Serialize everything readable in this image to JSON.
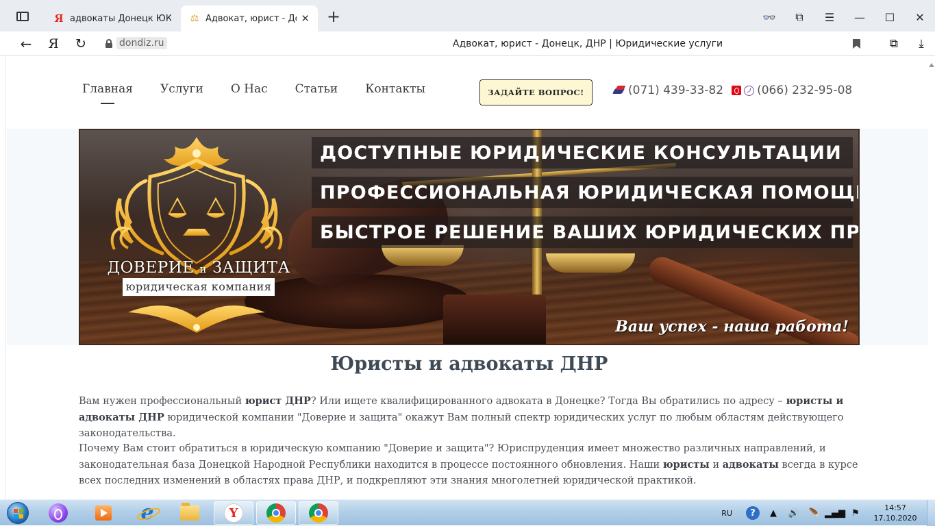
{
  "browser": {
    "tabs": [
      {
        "label": "адвокаты Донецк ЮК \"Дов",
        "favicon": "yandex-icon"
      },
      {
        "label": "Адвокат, юрист - Донец",
        "favicon": "scales-icon",
        "active": true
      }
    ],
    "address": {
      "domain": "dondiz.ru",
      "page_title": "Адвокат, юрист - Донецк, ДНР | Юридические услуги"
    }
  },
  "site": {
    "nav": [
      "Главная",
      "Услуги",
      "О Нас",
      "Статьи",
      "Контакты"
    ],
    "ask_button": "ЗАДАЙТЕ ВОПРОС!",
    "phone1": "(071) 439-33-82",
    "phone2": "(066) 232-95-08",
    "banner": {
      "slogan1": "ДОСТУПНЫЕ ЮРИДИЧЕСКИЕ КОНСУЛЬТАЦИИ",
      "slogan2": "ПРОФЕССИОНАЛЬНАЯ ЮРИДИЧЕСКАЯ ПОМОЩЬ",
      "slogan3": "БЫСТРОЕ РЕШЕНИЕ ВАШИХ ЮРИДИЧЕСКИХ ПРОБЛЕМ",
      "motto": "Ваш успех - наша работа!",
      "brand_word1": "ДОВЕРИЕ",
      "brand_conj": "и",
      "brand_word2": "ЗАЩИТА",
      "brand_sub": "юридическая компания"
    },
    "heading": "Юристы и адвокаты ДНР",
    "p1": {
      "a": "Вам нужен профессиональный ",
      "b1": "юрист ДНР",
      "c": "? Или ищете квалифицированного адвоката в Донецке? Тогда Вы обратились по адресу – ",
      "b2": "юристы и адвокаты ДНР",
      "d": " юридической компании \"Доверие и защита\" окажут Вам полный спектр юридических услуг по любым областям действующего законодательства."
    },
    "p2": {
      "a": "Почему Вам стоит обратиться в юридическую компанию \"Доверие и защита\"? Юриспруденция имеет множество различных направлений, и законодательная база Донецкой Народной Республики находится в процессе постоянного обновления. Наши ",
      "b1": "юристы",
      "c": " и ",
      "b2": "адвокаты",
      "d": " всегда в курсе всех последних изменений в областях права ДНР, и подкрепляют эти знания многолетней юридической практикой."
    }
  },
  "taskbar": {
    "lang": "RU",
    "time": "14:57",
    "date": "17.10.2020"
  },
  "colors": {
    "accent_gold": "#e8a723",
    "ask_button_bg": "#fdf7d4",
    "heading": "#3f4a55"
  }
}
